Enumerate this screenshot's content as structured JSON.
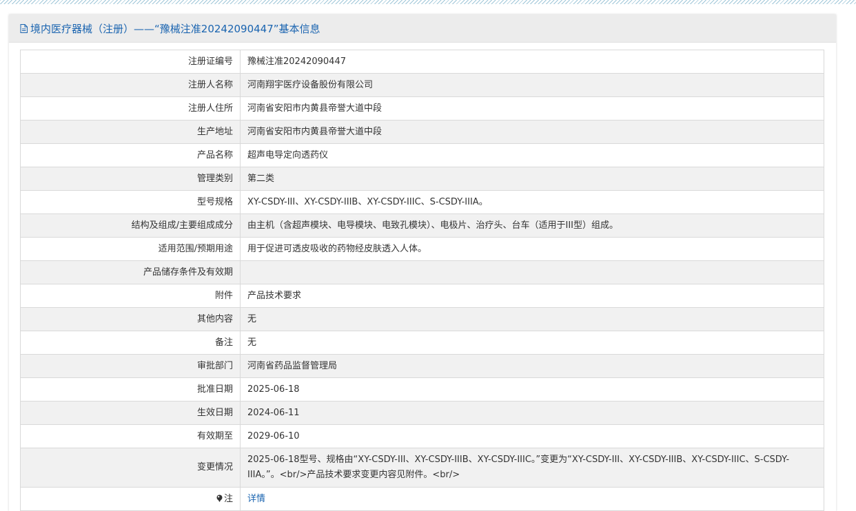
{
  "header": {
    "title": "境内医疗器械（注册）——“豫械注准20242090447”基本信息"
  },
  "rows": [
    {
      "label": "注册证编号",
      "value": "豫械注准20242090447"
    },
    {
      "label": "注册人名称",
      "value": "河南翔宇医疗设备股份有限公司"
    },
    {
      "label": "注册人住所",
      "value": "河南省安阳市内黄县帝誉大道中段"
    },
    {
      "label": "生产地址",
      "value": "河南省安阳市内黄县帝誉大道中段"
    },
    {
      "label": "产品名称",
      "value": "超声电导定向透药仪"
    },
    {
      "label": "管理类别",
      "value": "第二类"
    },
    {
      "label": "型号规格",
      "value": "XY-CSDY-III、XY-CSDY-IIIB、XY-CSDY-IIIC、S-CSDY-IIIA。"
    },
    {
      "label": "结构及组成/主要组成成分",
      "value": "由主机（含超声模块、电导模块、电致孔模块）、电极片、治疗头、台车（适用于III型）组成。"
    },
    {
      "label": "适用范围/预期用途",
      "value": "用于促进可透皮吸收的药物经皮肤透入人体。"
    },
    {
      "label": "产品储存条件及有效期",
      "value": ""
    },
    {
      "label": "附件",
      "value": "产品技术要求"
    },
    {
      "label": "其他内容",
      "value": "无"
    },
    {
      "label": "备注",
      "value": "无"
    },
    {
      "label": "审批部门",
      "value": "河南省药品监督管理局"
    },
    {
      "label": "批准日期",
      "value": "2025-06-18"
    },
    {
      "label": "生效日期",
      "value": "2024-06-11"
    },
    {
      "label": "有效期至",
      "value": "2029-06-10"
    },
    {
      "label": "变更情况",
      "value": "2025-06-18型号、规格由“XY-CSDY-III、XY-CSDY-IIIB、XY-CSDY-IIIC。”变更为“XY-CSDY-III、XY-CSDY-IIIB、XY-CSDY-IIIC、S-CSDY-IIIA。”。<br/>产品技术要求变更内容见附件。<br/>"
    }
  ],
  "note": {
    "label": "注",
    "link_text": "详情",
    "icon": "pin-icon"
  },
  "colors": {
    "accent": "#1a64b0",
    "header_bg": "#ececec",
    "row_alt": "#f1f1f1",
    "border": "#d9d9d9"
  }
}
